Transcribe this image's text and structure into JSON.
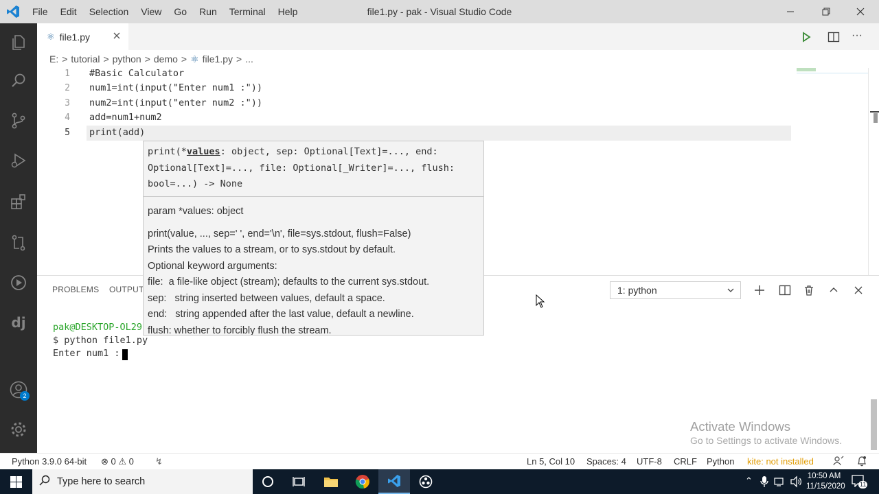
{
  "window": {
    "title": "file1.py - pak - Visual Studio Code"
  },
  "menu": [
    "File",
    "Edit",
    "Selection",
    "View",
    "Go",
    "Run",
    "Terminal",
    "Help"
  ],
  "tab": {
    "label": "file1.py"
  },
  "breadcrumb": [
    "E:",
    ">",
    "tutorial",
    ">",
    "python",
    ">",
    "demo",
    ">",
    "file1.py",
    ">",
    "..."
  ],
  "editor": {
    "lines": [
      {
        "num": "1",
        "text": "#Basic Calculator"
      },
      {
        "num": "2",
        "text": "num1=int(input(\"Enter num1 :\"))"
      },
      {
        "num": "3",
        "text": "num2=int(input(\"enter num2 :\"))"
      },
      {
        "num": "4",
        "text": "add=num1+num2"
      },
      {
        "num": "5",
        "text": "print(add)"
      }
    ]
  },
  "hover": {
    "sig_prefix": "print(*",
    "sig_param": "values",
    "sig_rest": ": object, sep: Optional[Text]=..., end: Optional[Text]=..., file: Optional[_Writer]=..., flush: bool=...) -> None",
    "param_line": "param *values: object",
    "doc": [
      "print(value, ..., sep=' ', end='\\n', file=sys.stdout, flush=False)",
      "Prints the values to a stream, or to sys.stdout by default.",
      "Optional keyword arguments:",
      "file:  a file-like object (stream); defaults to the current sys.stdout.",
      "sep:   string inserted between values, default a space.",
      "end:   string appended after the last value, default a newline.",
      "flush: whether to forcibly flush the stream."
    ]
  },
  "panel": {
    "tabs": [
      "PROBLEMS",
      "OUTPUT"
    ],
    "terminal_select": "1: python",
    "terminal_lines": [
      "pak@DESKTOP-OL29",
      "$ python file1.py",
      "Enter num1 :"
    ]
  },
  "status": {
    "interpreter": "Python 3.9.0 64-bit",
    "errors": "0",
    "warnings": "0",
    "position": "Ln 5, Col 10",
    "spaces": "Spaces: 4",
    "encoding": "UTF-8",
    "eol": "CRLF",
    "language": "Python",
    "kite": "kite: not installed",
    "notification_count": "2"
  },
  "watermark": {
    "line1": "Activate Windows",
    "line2": "Go to Settings to activate Windows."
  },
  "taskbar": {
    "search_placeholder": "Type here to search",
    "time": "10:50 AM",
    "date": "11/15/2020",
    "notif_count": "11"
  },
  "colors": {
    "accent": "#007acc",
    "python_icon": "#3572a5",
    "terminal_prompt": "#2aa52a",
    "kite": "#e09b00"
  },
  "icons": [
    "vscode-logo",
    "explorer-icon",
    "search-icon",
    "source-control-icon",
    "run-debug-icon",
    "extensions-icon",
    "git-compare-icon",
    "play-circle-icon",
    "django-icon",
    "account-icon",
    "gear-icon"
  ]
}
